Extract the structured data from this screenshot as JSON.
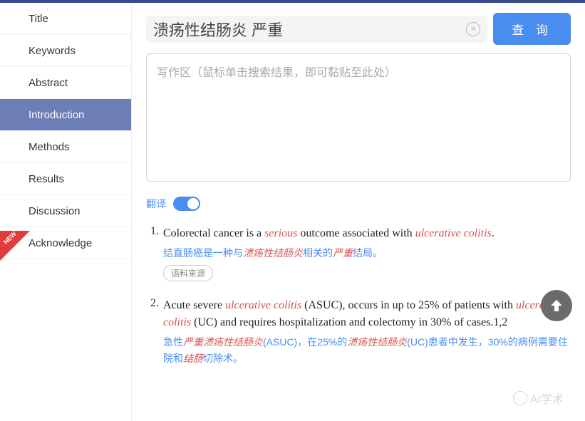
{
  "sidebar": {
    "items": [
      {
        "label": "Title"
      },
      {
        "label": "Keywords"
      },
      {
        "label": "Abstract"
      },
      {
        "label": "Introduction"
      },
      {
        "label": "Methods"
      },
      {
        "label": "Results"
      },
      {
        "label": "Discussion"
      },
      {
        "label": "Acknowledge"
      }
    ],
    "active_index": 3,
    "new_badge": "NEW"
  },
  "search": {
    "value": "溃疡性结肠炎 严重",
    "query_button": "查 询"
  },
  "writing_area": {
    "placeholder": "写作区（鼠标单击搜索结果，即可黏贴至此处）"
  },
  "translate": {
    "label": "翻译",
    "on": true
  },
  "results": [
    {
      "num": "1.",
      "en_parts": [
        {
          "t": "Colorectal cancer is a "
        },
        {
          "t": "serious",
          "hl": true
        },
        {
          "t": " outcome associated with "
        },
        {
          "t": "ulcerative colitis",
          "hl": true
        },
        {
          "t": "."
        }
      ],
      "zh_parts": [
        {
          "t": "结直肠癌是一种与"
        },
        {
          "t": "溃疡性结肠炎",
          "hl": true
        },
        {
          "t": "相关的"
        },
        {
          "t": "严重",
          "hl": true
        },
        {
          "t": "结局。"
        }
      ],
      "source_label": "语料来源"
    },
    {
      "num": "2.",
      "en_parts": [
        {
          "t": "Acute severe "
        },
        {
          "t": "ulcerative colitis",
          "hl": true
        },
        {
          "t": " (ASUC), occurs in up to 25% of patients with "
        },
        {
          "t": "ulcerative colitis",
          "hl": true
        },
        {
          "t": " (UC) and requires hospitalization and colectomy in 30% of cases.1,2"
        }
      ],
      "zh_parts": [
        {
          "t": "急性"
        },
        {
          "t": "严重溃疡性结肠炎",
          "hl": true
        },
        {
          "t": "(ASUC)，在25%的"
        },
        {
          "t": "溃疡性结肠炎",
          "hl": true
        },
        {
          "t": "(UC)患者中发生，30%的病例需要住院和"
        },
        {
          "t": "结肠",
          "hl": true
        },
        {
          "t": "切除术。"
        }
      ]
    }
  ],
  "watermark": "AI学术"
}
